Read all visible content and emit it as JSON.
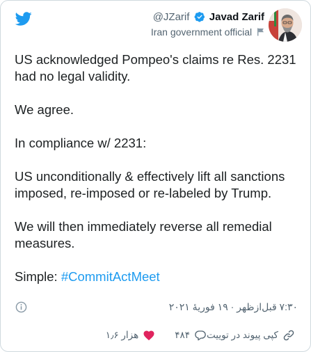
{
  "author": {
    "handle": "@JZarif",
    "display_name": "Javad Zarif",
    "label": "Iran government official"
  },
  "tweet": {
    "paragraphs": [
      "US acknowledged Pompeo's claims re Res. 2231 had no legal validity.",
      "We agree.",
      "In compliance w/ 2231:",
      "US unconditionally & effectively lift all sanctions imposed, re-imposed or re-labeled by Trump.",
      "We will then immediately reverse all remedial measures."
    ],
    "closing_prefix": "Simple: ",
    "hashtag": "#CommitActMeet"
  },
  "timestamp": "۷:۳۰ قبل‌ازظهر · ۱۹ فوریهٔ ۲۰۲۱",
  "actions": {
    "likes": "۱٫۶ هزار",
    "replies": "۴۸۴",
    "copy_link": "کپی پیوند در توییت"
  },
  "colors": {
    "twitter_blue": "#1d9bf0",
    "like_red": "#e0245e",
    "muted": "#536471"
  },
  "icons": [
    "twitter-bird-icon",
    "verified-badge-icon",
    "government-flag-icon",
    "info-icon",
    "heart-icon",
    "reply-icon",
    "link-icon"
  ]
}
